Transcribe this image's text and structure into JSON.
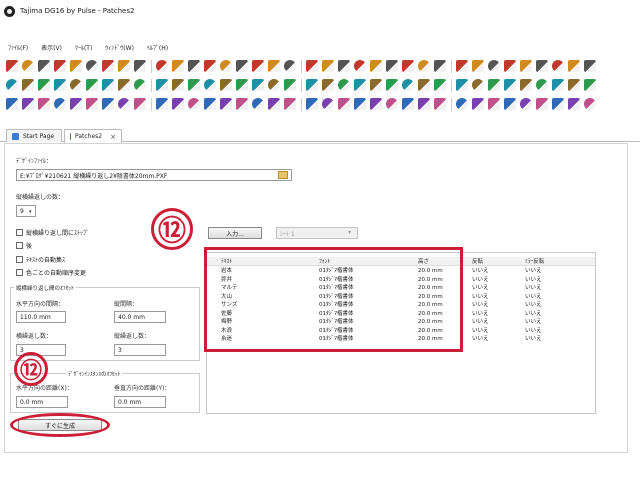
{
  "window": {
    "title": "Tajima DG16 by Pulse - Patches2"
  },
  "menu": [
    "ﾌｧｲﾙ(F)",
    "表示(V)",
    "ﾂｰﾙ(T)",
    "ｳｨﾝﾄﾞｳ(W)",
    "ﾍﾙﾌﾟ(H)"
  ],
  "tabs": {
    "start": "Start Page",
    "patches": "Patches2",
    "close": "×"
  },
  "form": {
    "design_file_label": "ﾃﾞｻﾞｲﾝﾌｧｲﾙ：",
    "design_file_path": "E:¥ﾌﾞﾛｸﾞ¥210621 縦横繰り返し2¥陰書体20mm.PXF",
    "repeat_count_label": "縦横繰返しの数：",
    "repeat_count_value": "9",
    "opt_stop": "縦横繰り返し間にｽﾄｯﾌﾟ",
    "opt_back": "後",
    "opt_text_auto": "ﾃｷｽﾄの自動集ｽ",
    "opt_color_order": "色ごとの自動順序変更",
    "offset_group": "縦横繰り返し間のｵﾌｾｯﾄ",
    "h_spacing_label": "水平方向の間隔：",
    "h_spacing_value": "110.0 mm",
    "v_spacing_label": "縦間隔：",
    "v_spacing_value": "40.0 mm",
    "h_repeat_label": "横繰返し数：",
    "h_repeat_value": "3",
    "v_repeat_label": "縦繰返し数：",
    "v_repeat_value": "3",
    "instance_group": "ﾃﾞｻﾞｲﾝｲﾝｽﾀﾝｽのｵﾌｾｯﾄ",
    "x_dist_label": "水平方向の距離(X)：",
    "x_dist_value": "0.0 mm",
    "y_dist_label": "垂直方向の距離(Y)：",
    "y_dist_value": "0.0 mm",
    "generate_button": "すぐに生成",
    "input_button": "入力...",
    "sheet_select": "ｼｰﾄ 1"
  },
  "table": {
    "headers": [
      "ﾃｷｽﾄ",
      "ﾌｫﾝﾄ",
      "高さ",
      "反転",
      "ﾐﾗｰ反転"
    ],
    "rows": [
      [
        "岩本",
        "01ﾀｼﾞﾏ楷書体",
        "20.0 mm",
        "いいえ",
        "いいえ"
      ],
      [
        "弥井",
        "01ﾀｼﾞﾏ楷書体",
        "20.0 mm",
        "いいえ",
        "いいえ"
      ],
      [
        "マルテ",
        "01ﾀｼﾞﾏ楷書体",
        "20.0 mm",
        "いいえ",
        "いいえ"
      ],
      [
        "大山",
        "01ﾀｼﾞﾏ楷書体",
        "20.0 mm",
        "いいえ",
        "いいえ"
      ],
      [
        "サンズ",
        "01ﾀｼﾞﾏ楷書体",
        "20.0 mm",
        "いいえ",
        "いいえ"
      ],
      [
        "佐藤",
        "01ﾀｼﾞﾏ楷書体",
        "20.0 mm",
        "いいえ",
        "いいえ"
      ],
      [
        "梅野",
        "01ﾀｼﾞﾏ楷書体",
        "20.0 mm",
        "いいえ",
        "いいえ"
      ],
      [
        "木浪",
        "01ﾀｼﾞﾏ楷書体",
        "20.0 mm",
        "いいえ",
        "いいえ"
      ],
      [
        "糸迷",
        "01ﾀｼﾞﾏ楷書体",
        "20.0 mm",
        "いいえ",
        "いいえ"
      ]
    ]
  },
  "annotations": {
    "marker": "⑫",
    "color": "#cc1e36"
  }
}
